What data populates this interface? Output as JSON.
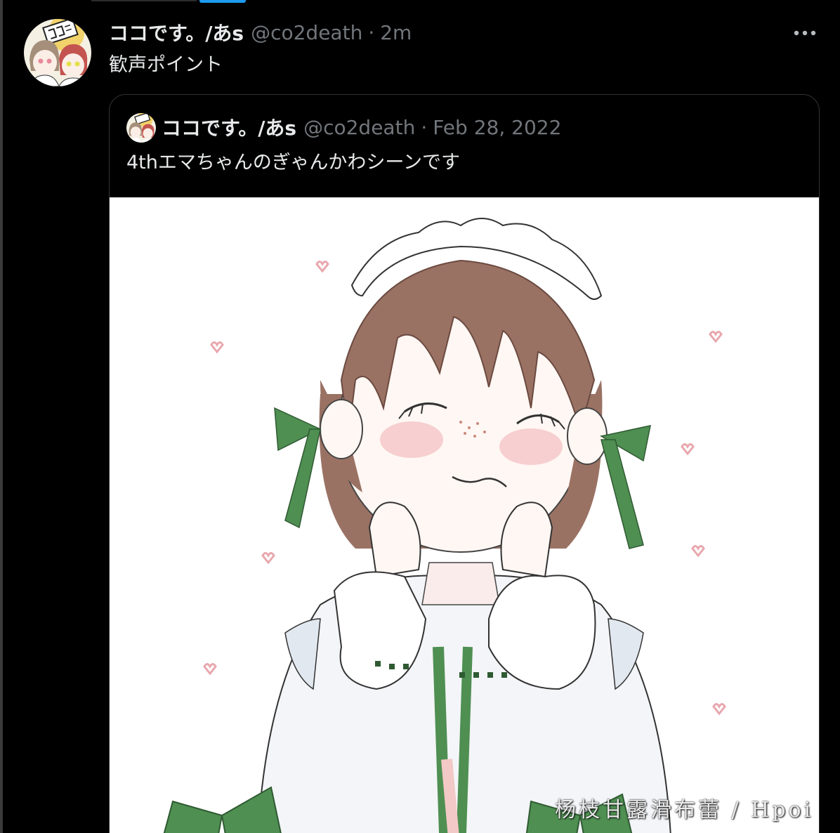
{
  "colors": {
    "background": "#000000",
    "text_primary": "#e7e9ea",
    "text_secondary": "#71767b",
    "border": "#2f3336",
    "accent": "#1d9bf0",
    "ribbon_green": "#4f8f52",
    "hair_brown": "#9a7264"
  },
  "tweet": {
    "display_name": "ココです。/あs",
    "handle": "@co2death",
    "separator": "·",
    "time": "2m",
    "text": "歓声ポイント",
    "more_icon": "more-horizontal-icon",
    "quoted": {
      "display_name": "ココです。/あs",
      "handle": "@co2death",
      "separator": "·",
      "date": "Feb 28, 2022",
      "text": "4thエマちゃんのぎゃんかわシーンです"
    }
  },
  "watermark": "杨枝甘露滑布蕾 / Hpoi"
}
